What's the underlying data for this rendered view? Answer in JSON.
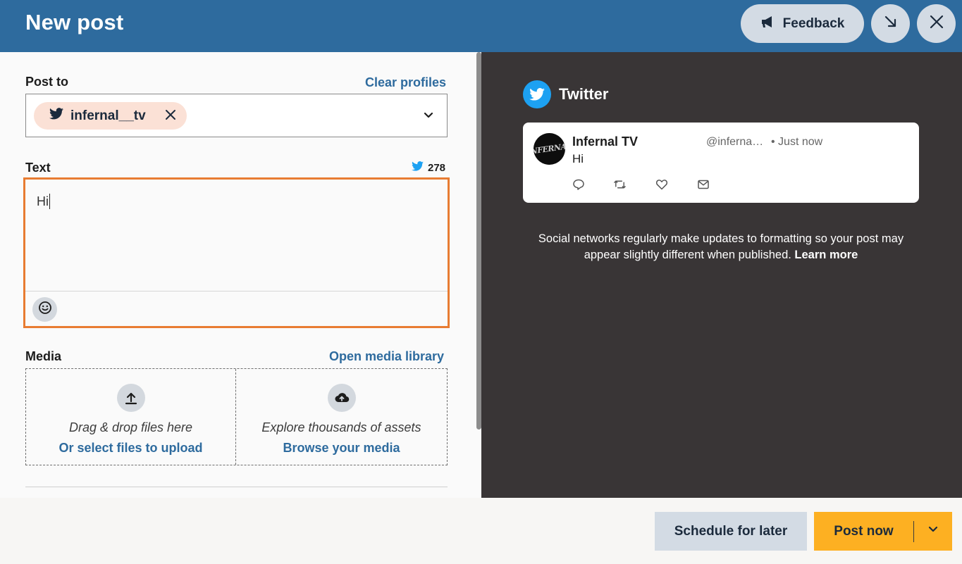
{
  "header": {
    "title": "New post",
    "feedback_label": "Feedback"
  },
  "post_to": {
    "label": "Post to",
    "clear_link": "Clear profiles",
    "selected_profile": "infernal__tv"
  },
  "text": {
    "label": "Text",
    "char_count": "278",
    "value": "Hi"
  },
  "media": {
    "label": "Media",
    "library_link": "Open media library",
    "upload_hint": "Drag & drop files here",
    "upload_action": "Or select files to upload",
    "explore_hint": "Explore thousands of assets",
    "explore_action": "Browse your media"
  },
  "preview": {
    "network": "Twitter",
    "tweet": {
      "display_name": "Infernal TV",
      "handle": "@inferna…",
      "time": "• Just now",
      "text": "Hi"
    },
    "notice_text": "Social networks regularly make updates to formatting so your post may appear slightly different when published.",
    "learn_more": "Learn more"
  },
  "footer": {
    "schedule_label": "Schedule for later",
    "post_label": "Post now"
  },
  "colors": {
    "header_bg": "#2e6b9e",
    "accent_link": "#2e6b9e",
    "focus_border": "#e87c32",
    "post_button": "#fdb022",
    "twitter_blue": "#1da1f2",
    "preview_bg": "#393536"
  }
}
